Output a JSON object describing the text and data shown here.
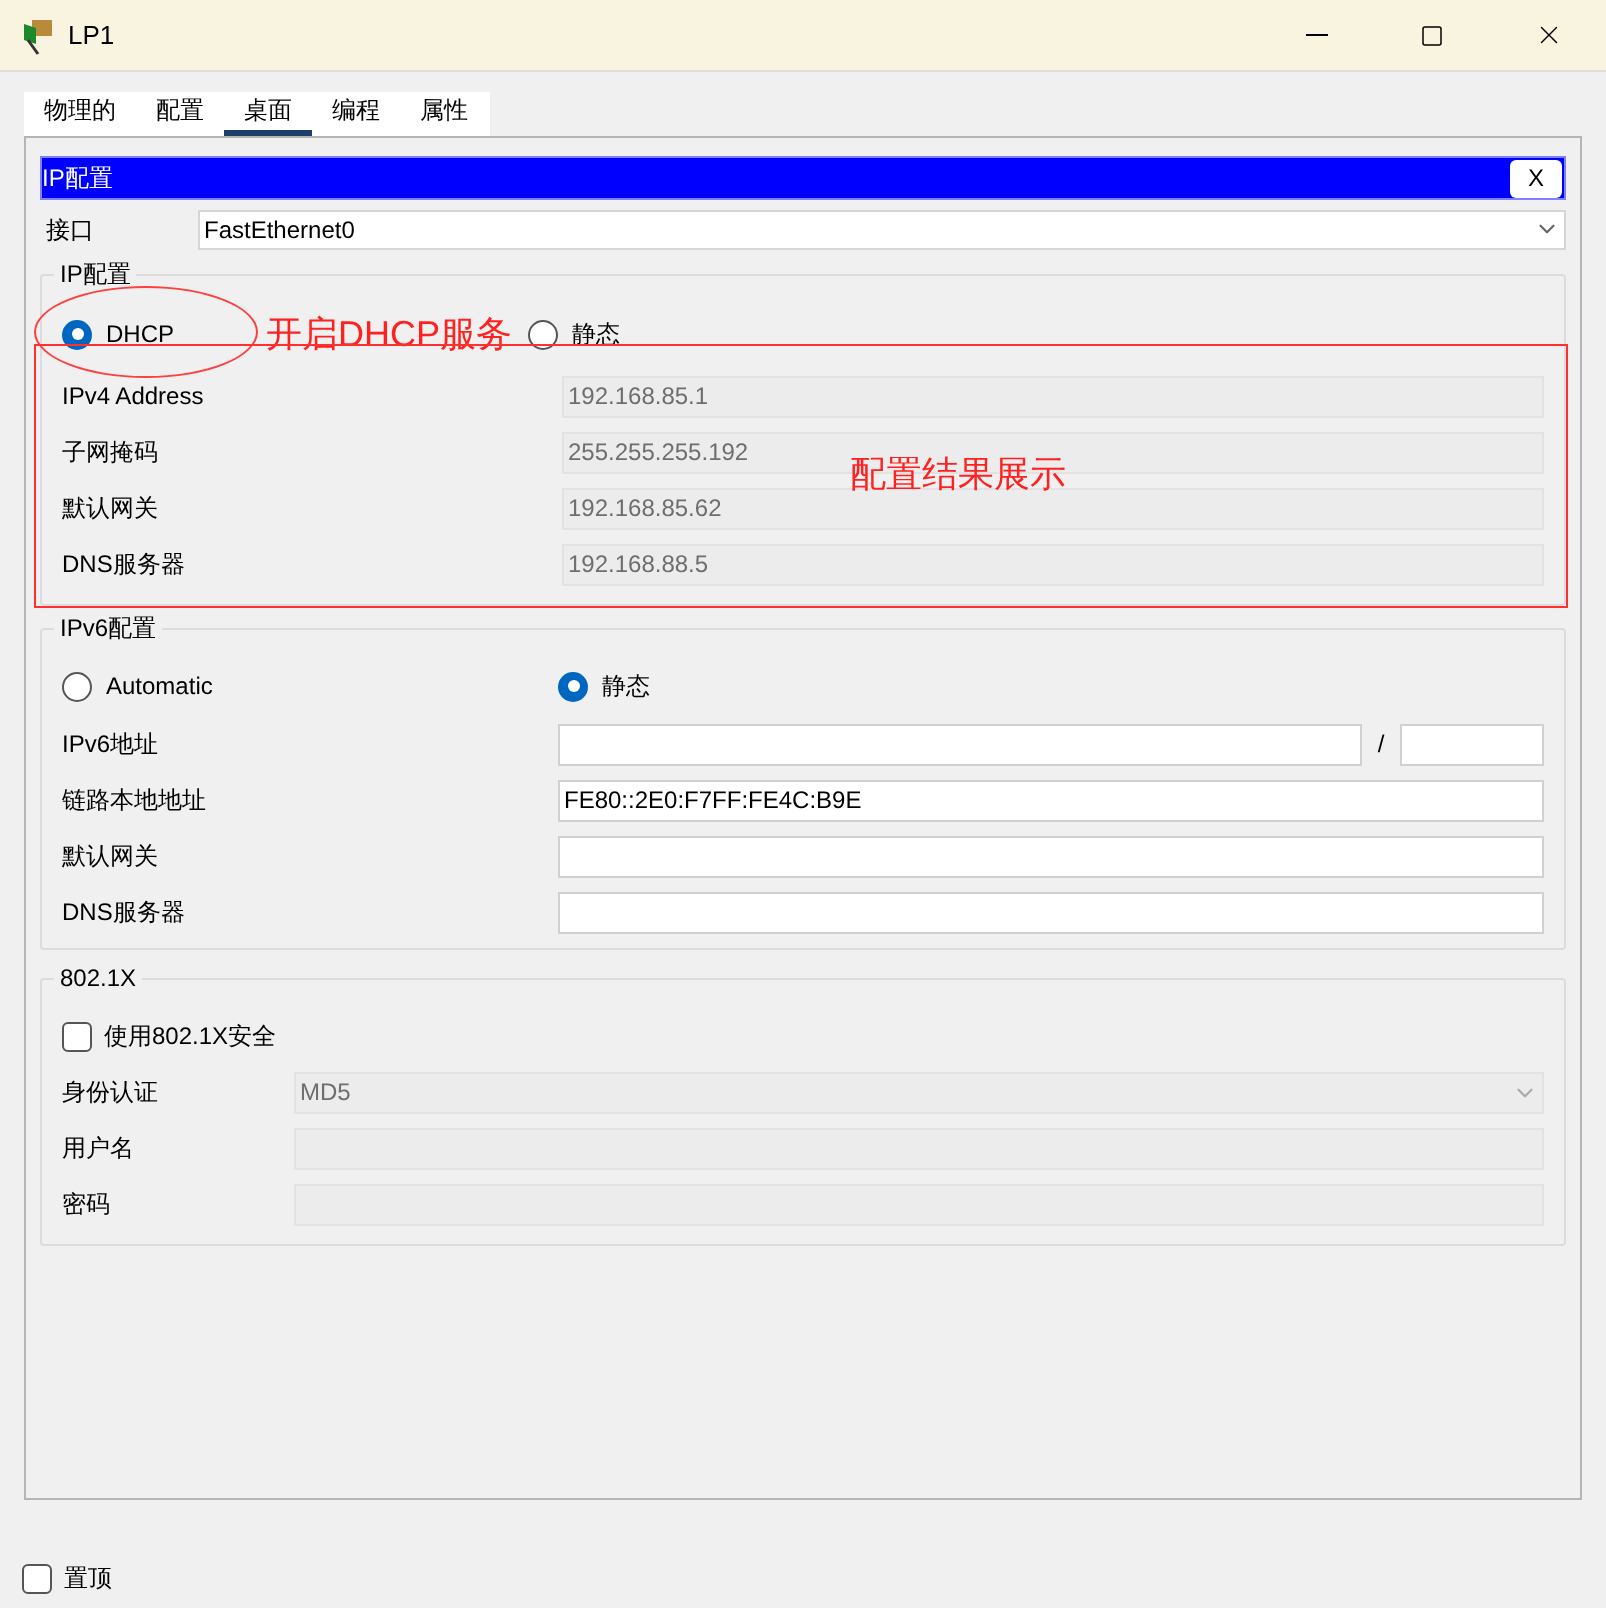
{
  "window": {
    "title": "LP1"
  },
  "tabs": [
    {
      "label": "物理的",
      "selected": false
    },
    {
      "label": "配置",
      "selected": false
    },
    {
      "label": "桌面",
      "selected": true
    },
    {
      "label": "编程",
      "selected": false
    },
    {
      "label": "属性",
      "selected": false
    }
  ],
  "panel": {
    "title": "IP配置",
    "close": "X"
  },
  "interface": {
    "label": "接口",
    "value": "FastEthernet0"
  },
  "ipv4": {
    "legend": "IP配置",
    "note": "开启DHCP服务",
    "result_note": "配置结果展示",
    "modes": [
      {
        "label": "DHCP",
        "selected": true
      },
      {
        "label": "静态",
        "selected": false
      }
    ],
    "fields": [
      {
        "label": "IPv4 Address",
        "value": "192.168.85.1",
        "disabled": true
      },
      {
        "label": "子网掩码",
        "value": "255.255.255.192",
        "disabled": true
      },
      {
        "label": "默认网关",
        "value": "192.168.85.62",
        "disabled": true
      },
      {
        "label": "DNS服务器",
        "value": "192.168.88.5",
        "disabled": true
      }
    ]
  },
  "ipv6": {
    "legend": "IPv6配置",
    "modes": [
      {
        "label": "Automatic",
        "selected": false
      },
      {
        "label": "静态",
        "selected": true
      }
    ],
    "fields": [
      {
        "label": "IPv6地址",
        "kind": "prefix",
        "separator": "/",
        "disabled": false
      },
      {
        "label": "链路本地地址",
        "kind": "text",
        "value": "FE80::2E0:F7FF:FE4C:B9E",
        "disabled": false
      },
      {
        "label": "默认网关",
        "kind": "text",
        "disabled": false
      },
      {
        "label": "DNS服务器",
        "kind": "text",
        "disabled": false
      }
    ]
  },
  "dot1x": {
    "legend": "802.1X",
    "use": {
      "label": "使用802.1X安全",
      "checked": false
    },
    "fields": [
      {
        "label": "身份认证",
        "kind": "select",
        "value": "MD5",
        "disabled": true
      },
      {
        "label": "用户名",
        "kind": "text",
        "disabled": true
      },
      {
        "label": "密码",
        "kind": "text",
        "disabled": true
      }
    ]
  },
  "always_on_top": {
    "label": "置顶",
    "checked": false
  }
}
